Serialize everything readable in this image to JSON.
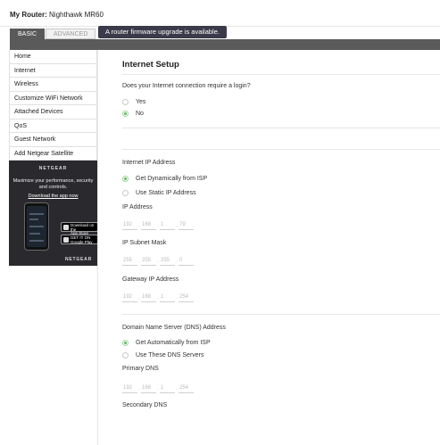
{
  "header": {
    "router_prefix": "My Router:",
    "router_name": "Nighthawk MR60"
  },
  "tabs": [
    {
      "label": "BASIC",
      "active": true
    },
    {
      "label": "ADVANCED",
      "active": false
    }
  ],
  "banner": {
    "text": "A router firmware upgrade is available."
  },
  "sidebar": {
    "items": [
      {
        "label": "Home"
      },
      {
        "label": "Internet"
      },
      {
        "label": "Wireless"
      },
      {
        "label": "Customize WiFi Network"
      },
      {
        "label": "Attached Devices"
      },
      {
        "label": "QoS"
      },
      {
        "label": "Guest Network"
      },
      {
        "label": "Add Netgear Satellite"
      }
    ]
  },
  "promo": {
    "logo": "NETGEAR",
    "text": "Maximize your performance, security and controls.",
    "link": "Download the app now",
    "app_store_small": "Download on the",
    "app_store": "App Store",
    "google_play_small": "GET IT ON",
    "google_play": "Google Play",
    "brand": "NETGEAR"
  },
  "main": {
    "title": "Internet Setup",
    "login_question": "Does your Internet connection require a login?",
    "login_options": [
      {
        "label": "Yes",
        "selected": false
      },
      {
        "label": "No",
        "selected": true
      }
    ],
    "internet_ip": {
      "heading": "Internet IP Address",
      "options": [
        {
          "label": "Get Dynamically from ISP",
          "selected": true
        },
        {
          "label": "Use Static IP Address",
          "selected": false
        }
      ],
      "ip_label": "IP Address",
      "ip": [
        "192",
        "168",
        "1",
        "79"
      ],
      "mask_label": "IP Subnet Mask",
      "mask": [
        "255",
        "255",
        "255",
        "0"
      ],
      "gateway_label": "Gateway IP Address",
      "gateway": [
        "192",
        "168",
        "1",
        "254"
      ]
    },
    "dns": {
      "heading": "Domain Name Server (DNS) Address",
      "options": [
        {
          "label": "Get Automatically from ISP",
          "selected": true
        },
        {
          "label": "Use These DNS Servers",
          "selected": false
        }
      ],
      "primary_label": "Primary DNS",
      "primary": [
        "192",
        "168",
        "1",
        "254"
      ],
      "secondary_label": "Secondary DNS"
    }
  },
  "colors": {
    "tab_active": "#5a5a5a",
    "banner_bg": "#3a3a4a",
    "radio_selected": "#5cb85c",
    "promo_bg": "#2a2a2e"
  }
}
